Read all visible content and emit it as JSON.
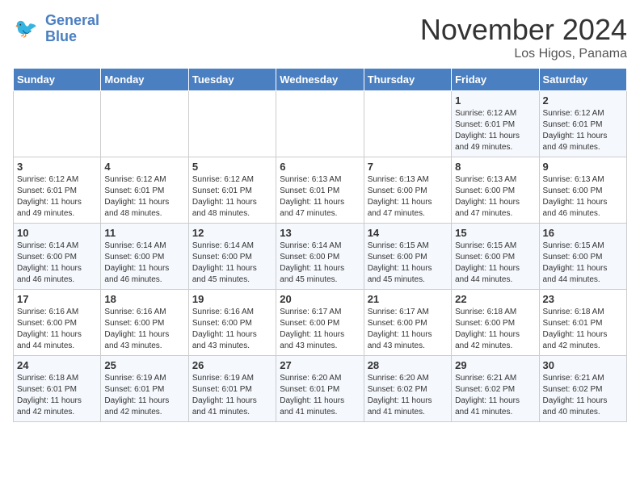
{
  "header": {
    "logo_line1": "General",
    "logo_line2": "Blue",
    "month": "November 2024",
    "location": "Los Higos, Panama"
  },
  "days_of_week": [
    "Sunday",
    "Monday",
    "Tuesday",
    "Wednesday",
    "Thursday",
    "Friday",
    "Saturday"
  ],
  "weeks": [
    [
      {
        "day": "",
        "info": ""
      },
      {
        "day": "",
        "info": ""
      },
      {
        "day": "",
        "info": ""
      },
      {
        "day": "",
        "info": ""
      },
      {
        "day": "",
        "info": ""
      },
      {
        "day": "1",
        "info": "Sunrise: 6:12 AM\nSunset: 6:01 PM\nDaylight: 11 hours\nand 49 minutes."
      },
      {
        "day": "2",
        "info": "Sunrise: 6:12 AM\nSunset: 6:01 PM\nDaylight: 11 hours\nand 49 minutes."
      }
    ],
    [
      {
        "day": "3",
        "info": "Sunrise: 6:12 AM\nSunset: 6:01 PM\nDaylight: 11 hours\nand 49 minutes."
      },
      {
        "day": "4",
        "info": "Sunrise: 6:12 AM\nSunset: 6:01 PM\nDaylight: 11 hours\nand 48 minutes."
      },
      {
        "day": "5",
        "info": "Sunrise: 6:12 AM\nSunset: 6:01 PM\nDaylight: 11 hours\nand 48 minutes."
      },
      {
        "day": "6",
        "info": "Sunrise: 6:13 AM\nSunset: 6:01 PM\nDaylight: 11 hours\nand 47 minutes."
      },
      {
        "day": "7",
        "info": "Sunrise: 6:13 AM\nSunset: 6:00 PM\nDaylight: 11 hours\nand 47 minutes."
      },
      {
        "day": "8",
        "info": "Sunrise: 6:13 AM\nSunset: 6:00 PM\nDaylight: 11 hours\nand 47 minutes."
      },
      {
        "day": "9",
        "info": "Sunrise: 6:13 AM\nSunset: 6:00 PM\nDaylight: 11 hours\nand 46 minutes."
      }
    ],
    [
      {
        "day": "10",
        "info": "Sunrise: 6:14 AM\nSunset: 6:00 PM\nDaylight: 11 hours\nand 46 minutes."
      },
      {
        "day": "11",
        "info": "Sunrise: 6:14 AM\nSunset: 6:00 PM\nDaylight: 11 hours\nand 46 minutes."
      },
      {
        "day": "12",
        "info": "Sunrise: 6:14 AM\nSunset: 6:00 PM\nDaylight: 11 hours\nand 45 minutes."
      },
      {
        "day": "13",
        "info": "Sunrise: 6:14 AM\nSunset: 6:00 PM\nDaylight: 11 hours\nand 45 minutes."
      },
      {
        "day": "14",
        "info": "Sunrise: 6:15 AM\nSunset: 6:00 PM\nDaylight: 11 hours\nand 45 minutes."
      },
      {
        "day": "15",
        "info": "Sunrise: 6:15 AM\nSunset: 6:00 PM\nDaylight: 11 hours\nand 44 minutes."
      },
      {
        "day": "16",
        "info": "Sunrise: 6:15 AM\nSunset: 6:00 PM\nDaylight: 11 hours\nand 44 minutes."
      }
    ],
    [
      {
        "day": "17",
        "info": "Sunrise: 6:16 AM\nSunset: 6:00 PM\nDaylight: 11 hours\nand 44 minutes."
      },
      {
        "day": "18",
        "info": "Sunrise: 6:16 AM\nSunset: 6:00 PM\nDaylight: 11 hours\nand 43 minutes."
      },
      {
        "day": "19",
        "info": "Sunrise: 6:16 AM\nSunset: 6:00 PM\nDaylight: 11 hours\nand 43 minutes."
      },
      {
        "day": "20",
        "info": "Sunrise: 6:17 AM\nSunset: 6:00 PM\nDaylight: 11 hours\nand 43 minutes."
      },
      {
        "day": "21",
        "info": "Sunrise: 6:17 AM\nSunset: 6:00 PM\nDaylight: 11 hours\nand 43 minutes."
      },
      {
        "day": "22",
        "info": "Sunrise: 6:18 AM\nSunset: 6:00 PM\nDaylight: 11 hours\nand 42 minutes."
      },
      {
        "day": "23",
        "info": "Sunrise: 6:18 AM\nSunset: 6:01 PM\nDaylight: 11 hours\nand 42 minutes."
      }
    ],
    [
      {
        "day": "24",
        "info": "Sunrise: 6:18 AM\nSunset: 6:01 PM\nDaylight: 11 hours\nand 42 minutes."
      },
      {
        "day": "25",
        "info": "Sunrise: 6:19 AM\nSunset: 6:01 PM\nDaylight: 11 hours\nand 42 minutes."
      },
      {
        "day": "26",
        "info": "Sunrise: 6:19 AM\nSunset: 6:01 PM\nDaylight: 11 hours\nand 41 minutes."
      },
      {
        "day": "27",
        "info": "Sunrise: 6:20 AM\nSunset: 6:01 PM\nDaylight: 11 hours\nand 41 minutes."
      },
      {
        "day": "28",
        "info": "Sunrise: 6:20 AM\nSunset: 6:02 PM\nDaylight: 11 hours\nand 41 minutes."
      },
      {
        "day": "29",
        "info": "Sunrise: 6:21 AM\nSunset: 6:02 PM\nDaylight: 11 hours\nand 41 minutes."
      },
      {
        "day": "30",
        "info": "Sunrise: 6:21 AM\nSunset: 6:02 PM\nDaylight: 11 hours\nand 40 minutes."
      }
    ]
  ]
}
